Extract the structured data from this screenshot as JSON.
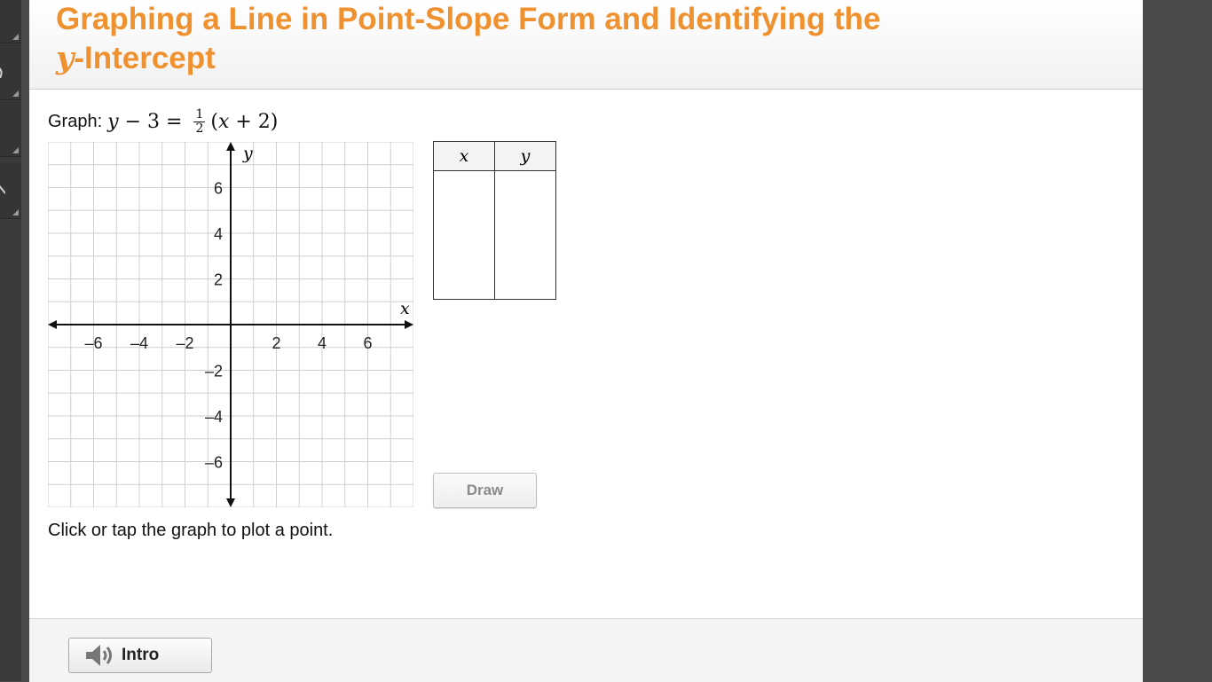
{
  "header": {
    "title_main": "Graphing a Line in Point-Slope Form and Identifying the",
    "title_var": "y",
    "title_rest": "-Intercept"
  },
  "problem": {
    "prompt_label": "Graph:",
    "eq_lhs_var": "y",
    "eq_lhs_rest": " − 3 = ",
    "eq_frac_num": "1",
    "eq_frac_den": "2",
    "eq_rhs_open": "(",
    "eq_rhs_var": "x",
    "eq_rhs_rest": " + 2)"
  },
  "graph": {
    "x_axis_label": "x",
    "y_axis_label": "y",
    "x_range": [
      -8,
      8
    ],
    "y_range": [
      -8,
      8
    ],
    "x_ticks": [
      "–6",
      "–4",
      "–2",
      "2",
      "4",
      "6"
    ],
    "y_ticks": [
      "6",
      "4",
      "2",
      "–2",
      "–4",
      "–6"
    ],
    "grid": true,
    "hint": "Click or tap the graph to plot a point."
  },
  "table": {
    "col_x": "x",
    "col_y": "y",
    "rows": [
      [
        "",
        ""
      ],
      [
        "",
        ""
      ],
      [
        "",
        ""
      ]
    ]
  },
  "buttons": {
    "draw": "Draw",
    "intro": "Intro"
  },
  "colors": {
    "title": "#f0912f",
    "grid_line": "#cfcfcf",
    "axis": "#111111"
  }
}
